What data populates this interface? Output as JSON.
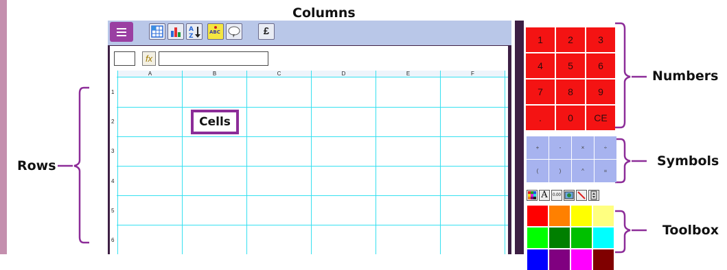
{
  "annotations": {
    "columns": "Columns",
    "rows": "Rows",
    "cells": "Cells",
    "numbers": "Numbers",
    "symbols": "Symbols",
    "toolbox": "Toolbox"
  },
  "toolbar": {
    "currency_label": "£",
    "icons": [
      "menu-icon",
      "table-icon",
      "bar-chart-icon",
      "sort-az-icon",
      "spellcheck-icon",
      "speech-bubble-icon"
    ]
  },
  "formula_bar": {
    "fx_label": "fx"
  },
  "columns": [
    "A",
    "B",
    "C",
    "D",
    "E",
    "F"
  ],
  "rows": [
    "1",
    "2",
    "3",
    "4",
    "5",
    "6"
  ],
  "numpad": {
    "keys": [
      "1",
      "2",
      "3",
      "4",
      "5",
      "6",
      "7",
      "8",
      "9",
      ".",
      "0",
      "CE"
    ]
  },
  "symbols": {
    "keys": [
      "+",
      "-",
      "×",
      "÷",
      "(",
      ")",
      "^",
      "="
    ]
  },
  "toolbox": {
    "tools": [
      "color-palette-icon",
      "font-icon",
      "decimal-format-icon",
      "image-icon",
      "line-tool-icon",
      "spinner-icon"
    ],
    "decimal_label": "0.00",
    "font_label": "A",
    "swatches": [
      "#ff0000",
      "#ff8000",
      "#ffff00",
      "#ffff80",
      "#00ff00",
      "#007f00",
      "#00c000",
      "#00ffff",
      "#0000ff",
      "#800080",
      "#ff00ff",
      "#800000"
    ]
  },
  "colors": {
    "accent_purple": "#8c2c98",
    "toolbar_bg": "#b9c7e8",
    "grid_line": "#34e0f0",
    "numpad_red": "#f41313",
    "symbol_blue": "#a7b3ef"
  }
}
